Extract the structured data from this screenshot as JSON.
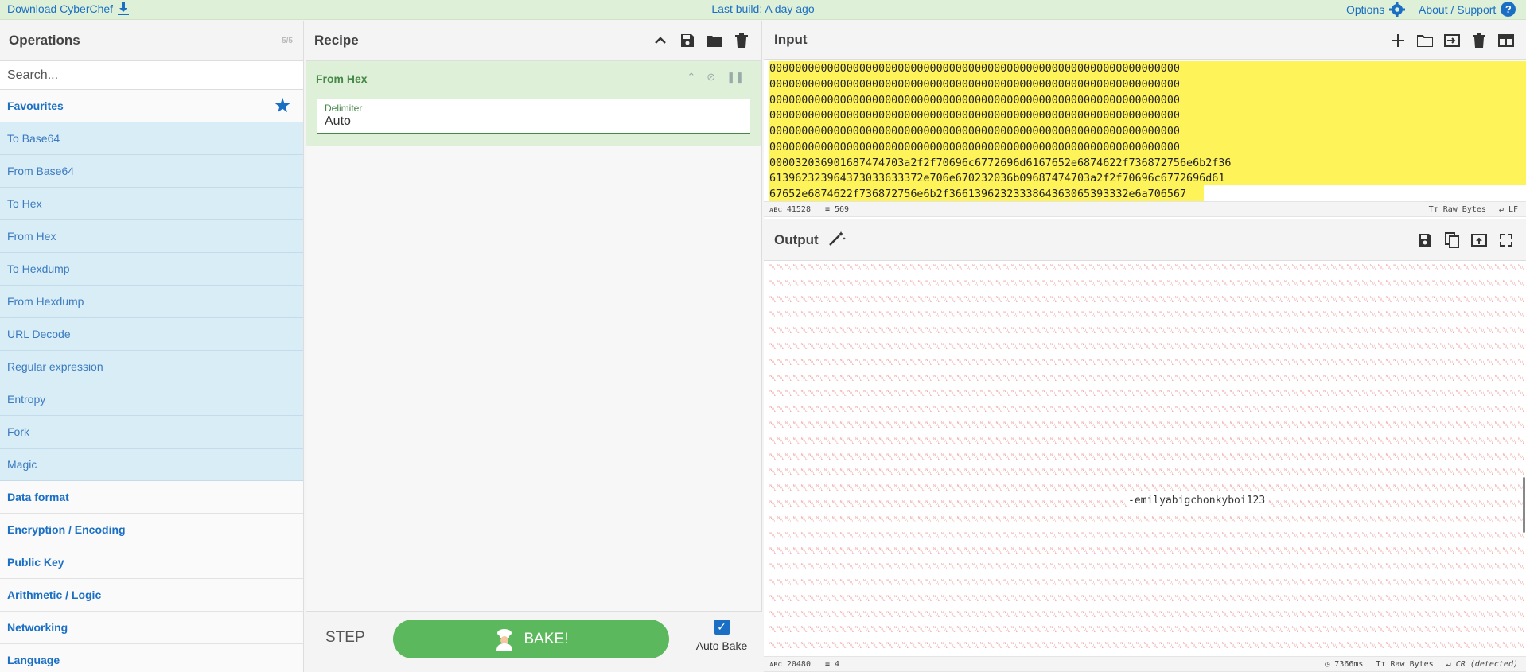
{
  "topbar": {
    "download_label": "Download CyberChef",
    "build_label": "Last build: A day ago",
    "options_label": "Options",
    "about_label": "About / Support"
  },
  "operations": {
    "title": "Operations",
    "count": "5/5",
    "search_placeholder": "Search...",
    "favourites_label": "Favourites",
    "favourite_items": [
      "To Base64",
      "From Base64",
      "To Hex",
      "From Hex",
      "To Hexdump",
      "From Hexdump",
      "URL Decode",
      "Regular expression",
      "Entropy",
      "Fork",
      "Magic"
    ],
    "categories": [
      "Data format",
      "Encryption / Encoding",
      "Public Key",
      "Arithmetic / Logic",
      "Networking",
      "Language"
    ]
  },
  "recipe": {
    "title": "Recipe",
    "operation": {
      "name": "From Hex",
      "arg_label": "Delimiter",
      "arg_value": "Auto"
    },
    "step_label": "STEP",
    "bake_label": "BAKE!",
    "autobake_label": "Auto Bake",
    "autobake_checked": true
  },
  "input": {
    "title": "Input",
    "lines": [
      "0000000000000000000000000000000000000000000000000000000000000000",
      "0000000000000000000000000000000000000000000000000000000000000000",
      "0000000000000000000000000000000000000000000000000000000000000000",
      "0000000000000000000000000000000000000000000000000000000000000000",
      "0000000000000000000000000000000000000000000000000000000000000000",
      "0000000000000000000000000000000000000000000000000000000000000000",
      "000032036901687474703a2f2f70696c6772696d6167652e6874622f736872756e6b2f36",
      "613962323964373033633372e706e670232036b09687474703a2f2f70696c6772696d61",
      "67652e6874622f736872756e6b2f3661396232333864363065393332e6a706567"
    ],
    "status_length": "41528",
    "status_lines": "569",
    "status_format": "Raw Bytes",
    "status_eol": "LF"
  },
  "output": {
    "title": "Output",
    "text": "-emilyabigchonkyboi123",
    "status_length": "20480",
    "status_lines": "4",
    "status_time": "7366ms",
    "status_format": "Raw Bytes",
    "status_eol": "CR (detected)"
  },
  "colors": {
    "accent": "#1a6fc4",
    "bake_green": "#5cb85c",
    "highlight_yellow": "#fff35a",
    "favourite_bg": "#d9edf7",
    "recipe_card_bg": "#dff0d8"
  }
}
